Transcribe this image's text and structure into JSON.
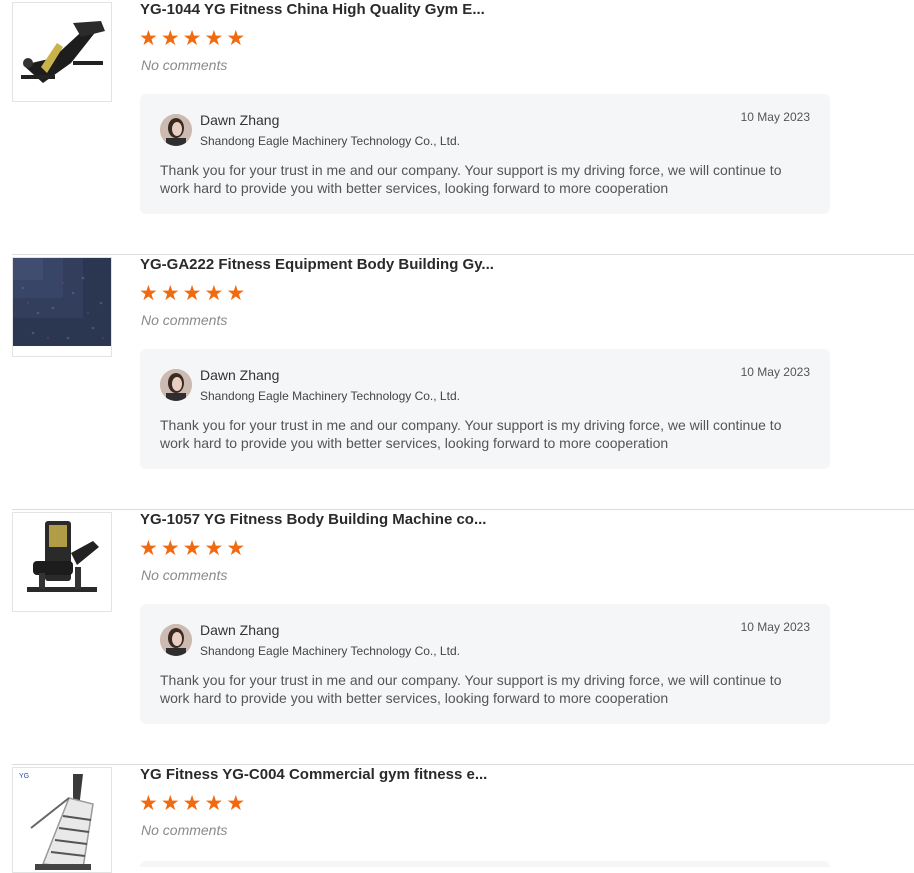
{
  "reviews": [
    {
      "product_title": "YG-1044 YG Fitness China High Quality Gym E...",
      "rating": 5,
      "comment": "No comments",
      "product_image": "hack-squat-machine",
      "reply": {
        "name": "Dawn Zhang",
        "company": "Shandong Eagle Machinery Technology Co., Ltd.",
        "date": "10 May 2023",
        "text": "Thank you for your trust in me and our company. Your support is my driving force, we will continue to work hard to provide you with better services, looking forward to more cooperation"
      }
    },
    {
      "product_title": "YG-GA222 Fitness Equipment Body Building Gy...",
      "rating": 5,
      "comment": "No comments",
      "product_image": "rubber-floor-mat",
      "reply": {
        "name": "Dawn Zhang",
        "company": "Shandong Eagle Machinery Technology Co., Ltd.",
        "date": "10 May 2023",
        "text": "Thank you for your trust in me and our company. Your support is my driving force, we will continue to work hard to provide you with better services, looking forward to more cooperation"
      }
    },
    {
      "product_title": "YG-1057 YG Fitness Body Building Machine co...",
      "rating": 5,
      "comment": "No comments",
      "product_image": "leg-curl-machine",
      "reply": {
        "name": "Dawn Zhang",
        "company": "Shandong Eagle Machinery Technology Co., Ltd.",
        "date": "10 May 2023",
        "text": "Thank you for your trust in me and our company. Your support is my driving force, we will continue to work hard to provide you with better services, looking forward to more cooperation"
      }
    },
    {
      "product_title": "YG Fitness YG-C004 Commercial gym fitness e...",
      "rating": 5,
      "comment": "No comments",
      "product_image": "stair-climber-machine"
    }
  ],
  "colors": {
    "star": "#f26a10",
    "reply_bg": "#f5f6f7",
    "separator": "#dcdcdc"
  }
}
